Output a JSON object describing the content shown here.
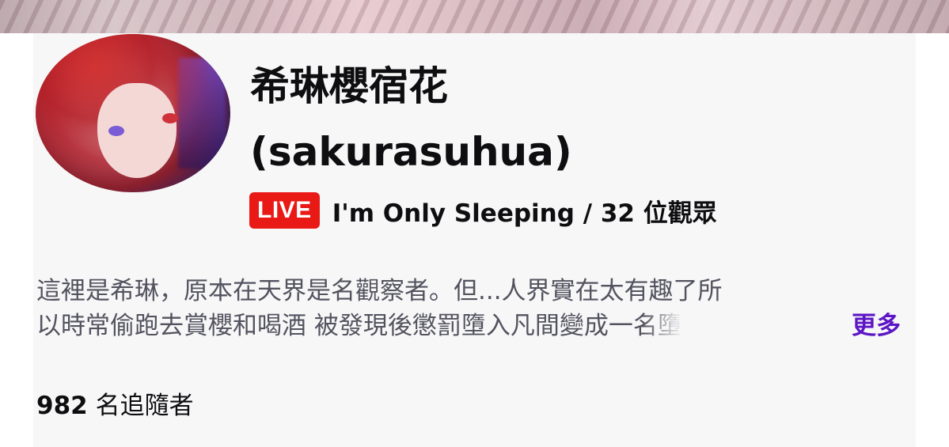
{
  "channel": {
    "display_name": "希琳櫻宿花",
    "login_name": "(sakurasuhua)",
    "live_badge": "LIVE",
    "stream_title": "I'm Only Sleeping",
    "separator": " / ",
    "viewers": "32 位觀眾"
  },
  "about": {
    "description_line_1": "這裡是希琳，原本在天界是名觀察者。但...人界實在太有趣了所",
    "description_line_2": "以時常偷跑去賞櫻和喝酒 被發現後懲罰墮入凡間變成一名墮",
    "more_label": "更多"
  },
  "followers": {
    "count": "982",
    "label": " 名追隨者"
  },
  "colors": {
    "live_badge_bg": "#e91916",
    "more_link": "#5c16c5",
    "card_bg": "#f7f7f8"
  }
}
